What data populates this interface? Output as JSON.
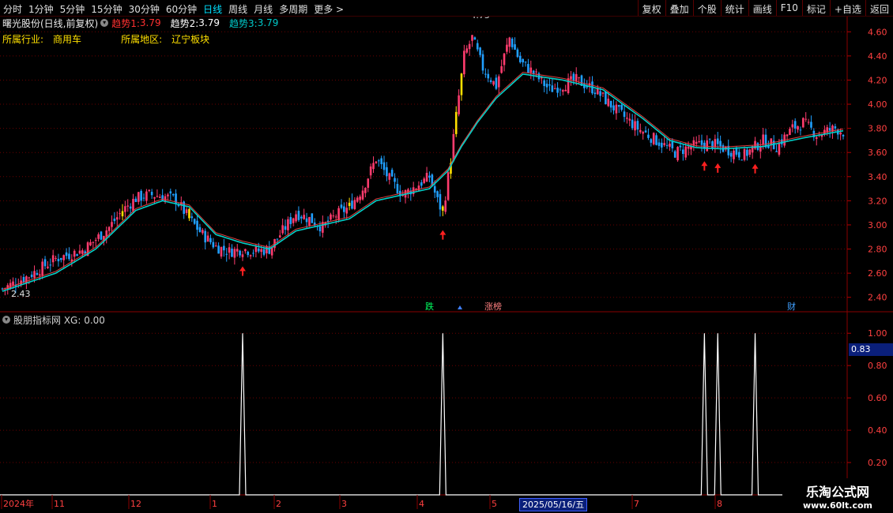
{
  "toolbar": {
    "periods": [
      "分时",
      "1分钟",
      "5分钟",
      "15分钟",
      "30分钟",
      "60分钟",
      "日线",
      "周线",
      "月线",
      "多周期",
      "更多 >"
    ],
    "active_period": "日线",
    "tools": [
      "复权",
      "叠加",
      "个股",
      "统计",
      "画线",
      "F10",
      "标记",
      "+自选",
      "返回"
    ]
  },
  "header": {
    "stock": "曙光股份(日线,前复权)",
    "trend1_label": "趋势1: ",
    "trend1_value": "3.79",
    "trend2_label": "趋势2: ",
    "trend2_value": "3.79",
    "trend3_label": "趋势3: ",
    "trend3_value": "3.79",
    "industry_label": "所属行业:",
    "industry": "商用车",
    "region_label": "所属地区:",
    "region": "辽宁板块"
  },
  "indicator": {
    "title": "股朋指标网 XG: 0.00",
    "current_value": "0.83"
  },
  "watermark": {
    "title": "乐淘公式网",
    "url": "www.60lt.com"
  },
  "colors": {
    "up": "#ff3c6e",
    "down": "#20a0ff",
    "trend": "#00d0c8",
    "trend2": "#e04040",
    "grid": "#6a0000",
    "yellow": "#ffe000"
  },
  "chart_data": {
    "type": "candlestick",
    "ylim": [
      2.3,
      4.7
    ],
    "yticks": [
      "4.60",
      "4.40",
      "4.20",
      "4.00",
      "3.80",
      "3.60",
      "3.40",
      "3.20",
      "3.00",
      "2.80",
      "2.60",
      "2.40"
    ],
    "max_label": "4.75",
    "min_label": "2.43",
    "x_labels": [
      "2024年",
      "11",
      "12",
      "1",
      "2",
      "3",
      "4",
      "5",
      "2025/05/16/五",
      "7",
      "8"
    ],
    "signal_labels": [
      "跌",
      "涨榜",
      "财"
    ],
    "close_path": [
      [
        0,
        2.47
      ],
      [
        10,
        2.58
      ],
      [
        20,
        2.72
      ],
      [
        30,
        2.79
      ],
      [
        35,
        2.88
      ],
      [
        40,
        2.98
      ],
      [
        45,
        3.12
      ],
      [
        50,
        3.22
      ],
      [
        55,
        3.25
      ],
      [
        60,
        3.24
      ],
      [
        65,
        3.21
      ],
      [
        70,
        3.05
      ],
      [
        75,
        2.92
      ],
      [
        80,
        2.82
      ],
      [
        85,
        2.78
      ],
      [
        90,
        2.8
      ],
      [
        95,
        2.78
      ],
      [
        100,
        2.8
      ],
      [
        105,
        2.95
      ],
      [
        110,
        3.1
      ],
      [
        115,
        3.05
      ],
      [
        120,
        2.98
      ],
      [
        125,
        3.08
      ],
      [
        130,
        3.15
      ],
      [
        135,
        3.3
      ],
      [
        140,
        3.55
      ],
      [
        145,
        3.38
      ],
      [
        150,
        3.25
      ],
      [
        155,
        3.32
      ],
      [
        160,
        3.4
      ],
      [
        163,
        3.2
      ],
      [
        165,
        3.1
      ],
      [
        168,
        3.55
      ],
      [
        170,
        3.9
      ],
      [
        173,
        4.4
      ],
      [
        176,
        4.55
      ],
      [
        180,
        4.3
      ],
      [
        185,
        4.15
      ],
      [
        188,
        4.4
      ],
      [
        190,
        4.55
      ],
      [
        194,
        4.35
      ],
      [
        198,
        4.28
      ],
      [
        205,
        4.12
      ],
      [
        215,
        4.2
      ],
      [
        222,
        4.12
      ],
      [
        230,
        3.95
      ],
      [
        238,
        3.8
      ],
      [
        245,
        3.7
      ],
      [
        252,
        3.6
      ],
      [
        258,
        3.65
      ],
      [
        265,
        3.68
      ],
      [
        272,
        3.62
      ],
      [
        278,
        3.58
      ],
      [
        285,
        3.7
      ],
      [
        290,
        3.65
      ],
      [
        296,
        3.8
      ],
      [
        300,
        3.85
      ],
      [
        305,
        3.75
      ],
      [
        312,
        3.8
      ],
      [
        315,
        3.77
      ]
    ],
    "trend_path": [
      [
        0,
        2.45
      ],
      [
        20,
        2.6
      ],
      [
        35,
        2.8
      ],
      [
        50,
        3.12
      ],
      [
        60,
        3.2
      ],
      [
        70,
        3.15
      ],
      [
        80,
        2.92
      ],
      [
        90,
        2.85
      ],
      [
        100,
        2.8
      ],
      [
        110,
        2.95
      ],
      [
        120,
        3.0
      ],
      [
        130,
        3.05
      ],
      [
        140,
        3.2
      ],
      [
        150,
        3.25
      ],
      [
        160,
        3.3
      ],
      [
        167,
        3.45
      ],
      [
        172,
        3.65
      ],
      [
        178,
        3.85
      ],
      [
        185,
        4.05
      ],
      [
        195,
        4.25
      ],
      [
        210,
        4.2
      ],
      [
        225,
        4.12
      ],
      [
        240,
        3.88
      ],
      [
        250,
        3.7
      ],
      [
        260,
        3.64
      ],
      [
        270,
        3.63
      ],
      [
        285,
        3.65
      ],
      [
        300,
        3.72
      ],
      [
        315,
        3.78
      ]
    ],
    "signal_days": [
      90,
      165,
      263,
      268,
      282
    ],
    "xg": {
      "ylim": [
        0,
        1.05
      ],
      "yticks": [
        "1.00",
        "0.80",
        "0.60",
        "0.40",
        "0.20"
      ],
      "spikes": [
        90,
        165,
        263,
        268,
        282
      ],
      "spike_value": 1.0
    }
  }
}
